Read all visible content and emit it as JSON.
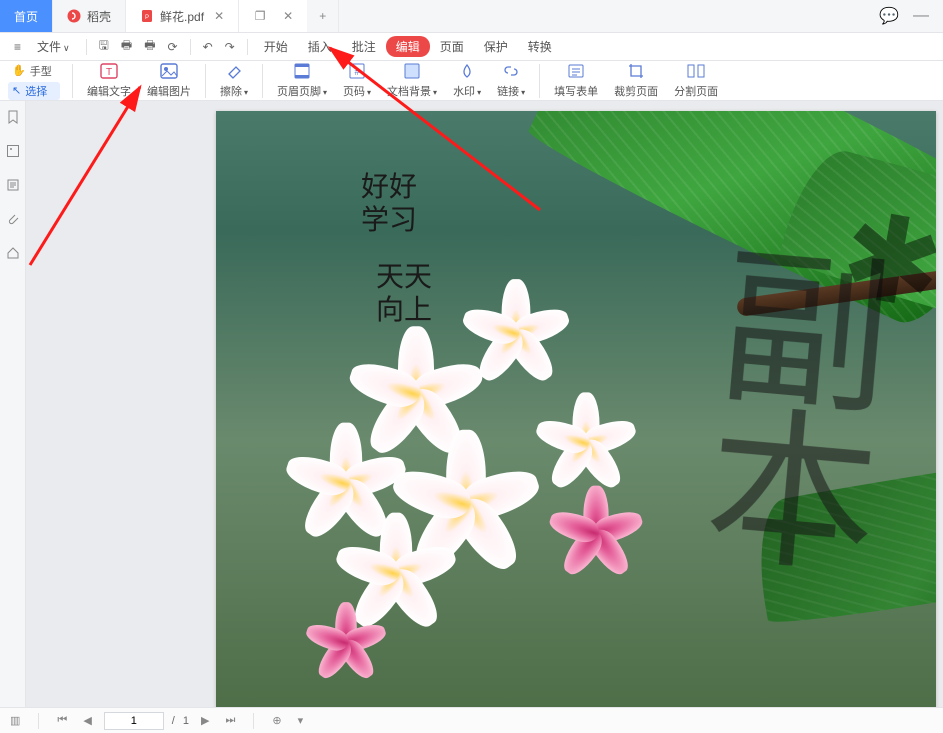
{
  "tabs": {
    "home": "首页",
    "daoke": "稻壳",
    "file": "鲜花.pdf",
    "add": "+"
  },
  "menubar": {
    "file_menu": "文件",
    "items": {
      "start": "开始",
      "insert": "插入",
      "annotate": "批注",
      "edit": "编辑",
      "page": "页面",
      "protect": "保护",
      "convert": "转换"
    }
  },
  "ribbon": {
    "hand": "手型",
    "select": "选择",
    "edit_text": "编辑文字",
    "edit_image": "编辑图片",
    "erase": "擦除",
    "header_footer": "页眉页脚",
    "page_number": "页码",
    "background": "文档背景",
    "watermark": "水印",
    "link": "链接",
    "fill_form": "填写表单",
    "crop_page": "裁剪页面",
    "split_page": "分割页面"
  },
  "overlay": {
    "line1a": "好好",
    "line1b": "学习",
    "line2a": "天天",
    "line2b": "向上"
  },
  "watermark_text": "副本",
  "statusbar": {
    "page_current": "1",
    "page_sep": "/",
    "page_total": "1"
  }
}
